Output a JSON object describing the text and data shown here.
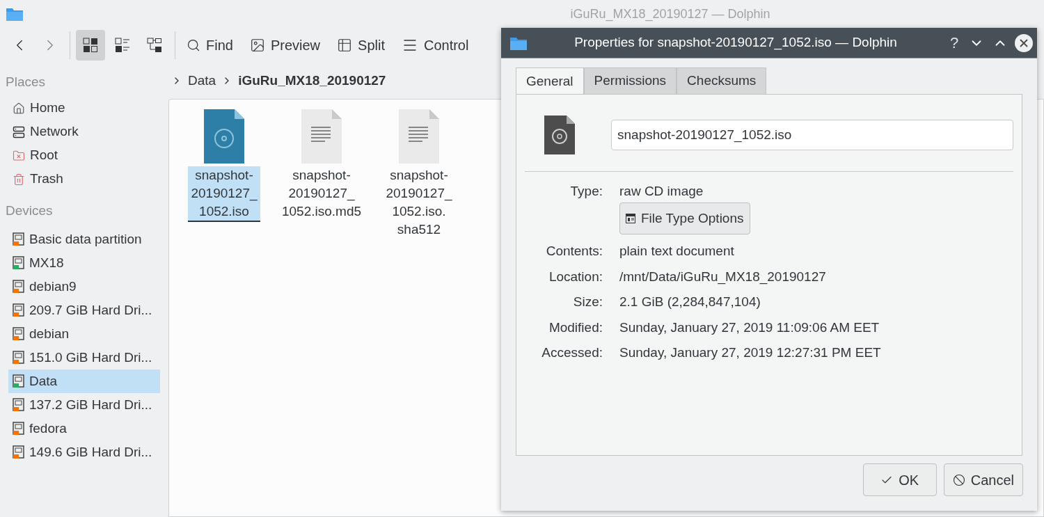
{
  "window": {
    "title": "iGuRu_MX18_20190127 — Dolphin"
  },
  "toolbar": {
    "view_modes": [
      {
        "kind": "icons",
        "selected": true
      },
      {
        "kind": "details",
        "selected": false
      },
      {
        "kind": "tree",
        "selected": false
      }
    ],
    "actions": [
      {
        "kind": "find",
        "label": "Find"
      },
      {
        "kind": "preview",
        "label": "Preview"
      },
      {
        "kind": "split",
        "label": "Split"
      },
      {
        "kind": "control",
        "label": "Control"
      }
    ]
  },
  "sidebar": {
    "places_heading": "Places",
    "places": [
      {
        "kind": "home",
        "label": "Home",
        "selected": false
      },
      {
        "kind": "network",
        "label": "Network",
        "selected": false
      },
      {
        "kind": "root",
        "label": "Root",
        "selected": false
      },
      {
        "kind": "trash",
        "label": "Trash",
        "selected": false
      }
    ],
    "devices_heading": "Devices",
    "devices": [
      {
        "label": "Basic data partition",
        "color": "#f67400",
        "selected": false
      },
      {
        "label": "MX18",
        "color": "#27ae60",
        "selected": false
      },
      {
        "label": "debian9",
        "color": "#f67400",
        "selected": false
      },
      {
        "label": "209.7 GiB Hard Dri...",
        "color": "#f67400",
        "selected": false
      },
      {
        "label": "debian",
        "color": "#f67400",
        "selected": false
      },
      {
        "label": "151.0 GiB Hard Dri...",
        "color": "#f67400",
        "selected": false
      },
      {
        "label": "Data",
        "color": "#27ae60",
        "selected": true
      },
      {
        "label": "137.2 GiB Hard Dri...",
        "color": "#f67400",
        "selected": false
      },
      {
        "label": "fedora",
        "color": "#f67400",
        "selected": false
      },
      {
        "label": "149.6 GiB Hard Dri...",
        "color": "#f67400",
        "selected": false
      }
    ]
  },
  "breadcrumb": [
    {
      "label": "Data",
      "current": false
    },
    {
      "label": "iGuRu_MX18_20190127",
      "current": true
    }
  ],
  "files": [
    {
      "kind": "disc",
      "lines": [
        "snapshot-",
        "20190127_",
        "1052.iso"
      ],
      "selected": true
    },
    {
      "kind": "text",
      "lines": [
        "snapshot-",
        "20190127_",
        "1052.iso.md5"
      ],
      "selected": false
    },
    {
      "kind": "text",
      "lines": [
        "snapshot-",
        "20190127_",
        "1052.iso.",
        "sha512"
      ],
      "selected": false
    }
  ],
  "dialog": {
    "title": "Properties for snapshot-20190127_1052.iso — Dolphin",
    "title_buttons": [
      "?"
    ],
    "tabs": [
      {
        "label": "General",
        "selected": true
      },
      {
        "label": "Permissions",
        "selected": false
      },
      {
        "label": "Checksums",
        "selected": false
      }
    ],
    "name_value": "snapshot-20190127_1052.iso",
    "type_label": "Type:",
    "type_value": "raw CD image",
    "file_type_button": "File Type Options",
    "properties": [
      {
        "label": "Contents:",
        "value": "plain text document"
      },
      {
        "label": "Location:",
        "value": "/mnt/Data/iGuRu_MX18_20190127"
      },
      {
        "label": "Size:",
        "value": "2.1 GiB (2,284,847,104)"
      },
      {
        "label": "Modified:",
        "value": "Sunday, January 27, 2019 11:09:06 AM EET"
      },
      {
        "label": "Accessed:",
        "value": "Sunday, January 27, 2019 12:27:31 PM EET"
      }
    ],
    "buttons": [
      {
        "kind": "ok",
        "label": "OK"
      },
      {
        "kind": "cancel",
        "label": "Cancel"
      }
    ]
  }
}
